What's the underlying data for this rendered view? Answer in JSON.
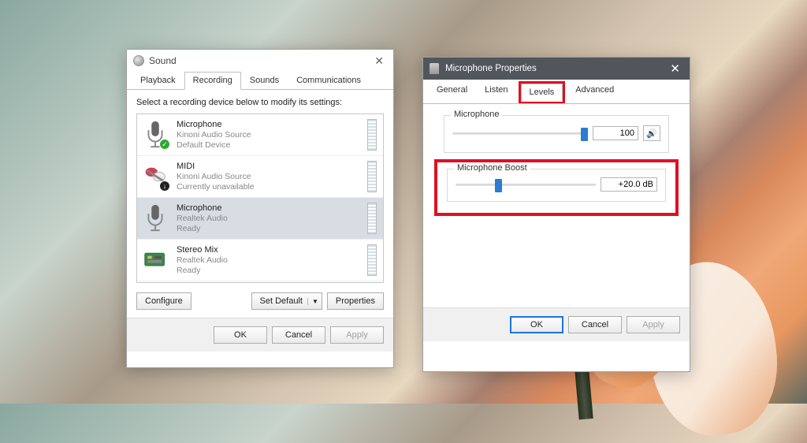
{
  "sound": {
    "title": "Sound",
    "tabs": [
      "Playback",
      "Recording",
      "Sounds",
      "Communications"
    ],
    "active_tab": 1,
    "instruction": "Select a recording device below to modify its settings:",
    "devices": [
      {
        "name": "Microphone",
        "source": "Kinoni Audio Source",
        "status": "Default Device",
        "badge": "check"
      },
      {
        "name": "MIDI",
        "source": "Kinoni Audio Source",
        "status": "Currently unavailable",
        "badge": "warn"
      },
      {
        "name": "Microphone",
        "source": "Realtek Audio",
        "status": "Ready",
        "badge": ""
      },
      {
        "name": "Stereo Mix",
        "source": "Realtek Audio",
        "status": "Ready",
        "badge": ""
      }
    ],
    "selected": 2,
    "buttons": {
      "configure": "Configure",
      "set_default": "Set Default",
      "properties": "Properties"
    },
    "footer": {
      "ok": "OK",
      "cancel": "Cancel",
      "apply": "Apply"
    }
  },
  "props": {
    "title": "Microphone Properties",
    "tabs": [
      "General",
      "Listen",
      "Levels",
      "Advanced"
    ],
    "active_tab": 2,
    "mic": {
      "label": "Microphone",
      "value": "100",
      "pct": 100
    },
    "boost": {
      "label": "Microphone Boost",
      "value": "+20.0 dB",
      "pct": 28
    },
    "footer": {
      "ok": "OK",
      "cancel": "Cancel",
      "apply": "Apply"
    }
  }
}
